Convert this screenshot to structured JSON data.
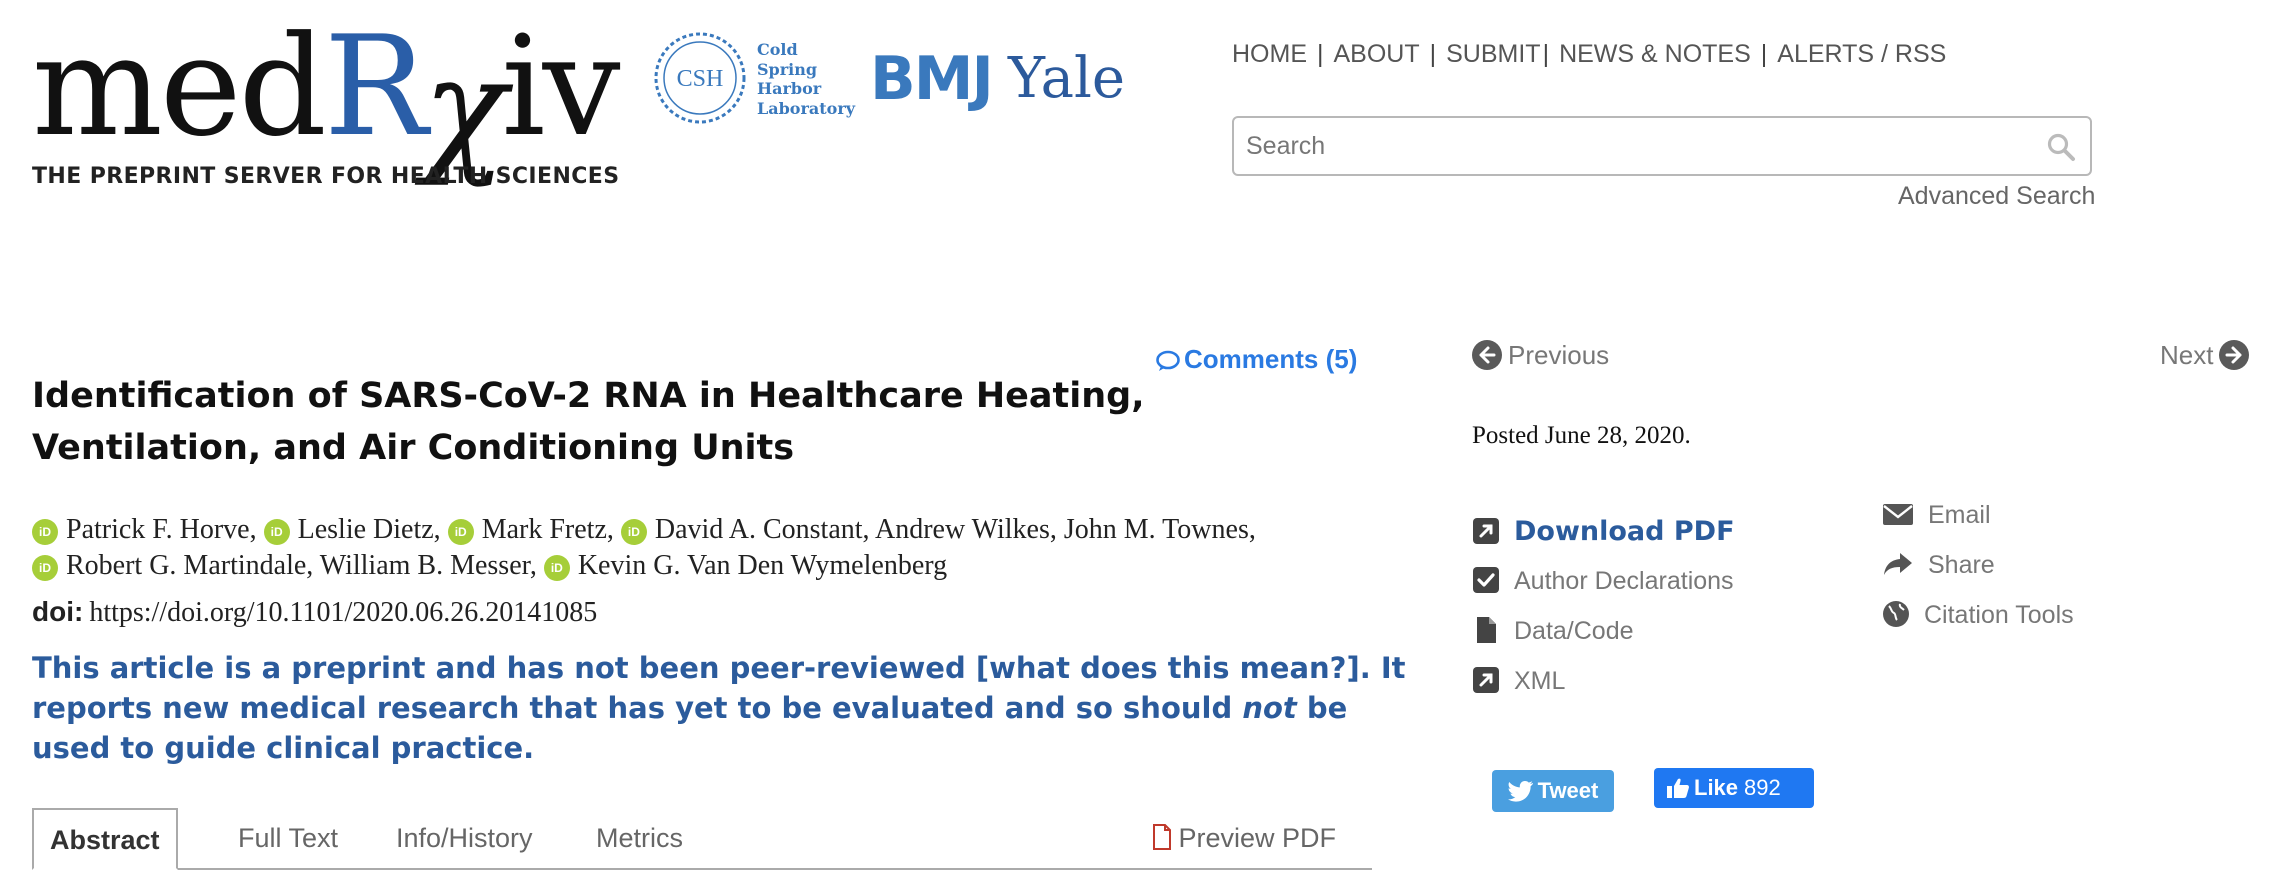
{
  "header": {
    "logo_parts": [
      "med",
      "R",
      "χ",
      "iv"
    ],
    "tagline": "THE PREPRINT SERVER FOR HEALTH SCIENCES",
    "partners": {
      "csh_badge": "CSH",
      "csh_lines": [
        "Cold",
        "Spring",
        "Harbor",
        "Laboratory"
      ],
      "bmj": "BMJ",
      "yale": "Yale"
    }
  },
  "nav": {
    "items": [
      "HOME",
      "ABOUT",
      "SUBMIT",
      "NEWS & NOTES",
      "ALERTS / RSS"
    ],
    "separator": "|"
  },
  "search": {
    "placeholder": "Search",
    "advanced_label": "Advanced Search"
  },
  "article": {
    "comments_label": "Comments (5)",
    "title": "Identification of SARS-CoV-2 RNA in Healthcare Heating, Ventilation, and Air Conditioning Units",
    "orcid_badge": "iD",
    "authors_line1": [
      {
        "name": "Patrick F. Horve,",
        "orcid": true
      },
      {
        "name": "Leslie Dietz,",
        "orcid": true
      },
      {
        "name": "Mark Fretz,",
        "orcid": true
      },
      {
        "name": "David A. Constant, Andrew Wilkes, John M. Townes,",
        "orcid": true
      }
    ],
    "authors_line2": [
      {
        "name": "Robert G. Martindale, William B. Messer,",
        "orcid": true
      },
      {
        "name": "Kevin G. Van Den Wymelenberg",
        "orcid": true
      }
    ],
    "doi_label": "doi:",
    "doi_value": "https://doi.org/10.1101/2020.06.26.20141085",
    "notice_part1": "This article is a preprint and has not been peer-reviewed ",
    "notice_link": "[what does this mean?]",
    "notice_part2": ". It reports new medical research that has yet to be evaluated and so should ",
    "notice_em": "not",
    "notice_part3": " be used to guide clinical practice."
  },
  "tabs": {
    "items": [
      "Abstract",
      "Full Text",
      "Info/History",
      "Metrics"
    ],
    "active": "Abstract",
    "preview_pdf": "Preview PDF"
  },
  "sidebar": {
    "previous": "Previous",
    "next": "Next",
    "posted": "Posted June 28, 2020.",
    "tools_left": [
      "Download PDF",
      "Author Declarations",
      "Data/Code",
      "XML"
    ],
    "tools_right": [
      "Email",
      "Share",
      "Citation Tools"
    ],
    "tweet": "Tweet",
    "like": "Like",
    "like_count": "892"
  },
  "colors": {
    "brand_blue": "#2b5b9c",
    "link_blue": "#2a7ae2",
    "orcid_green": "#a6ce39",
    "twitter_blue": "#4a9fe0",
    "facebook_blue": "#1f78f2"
  }
}
